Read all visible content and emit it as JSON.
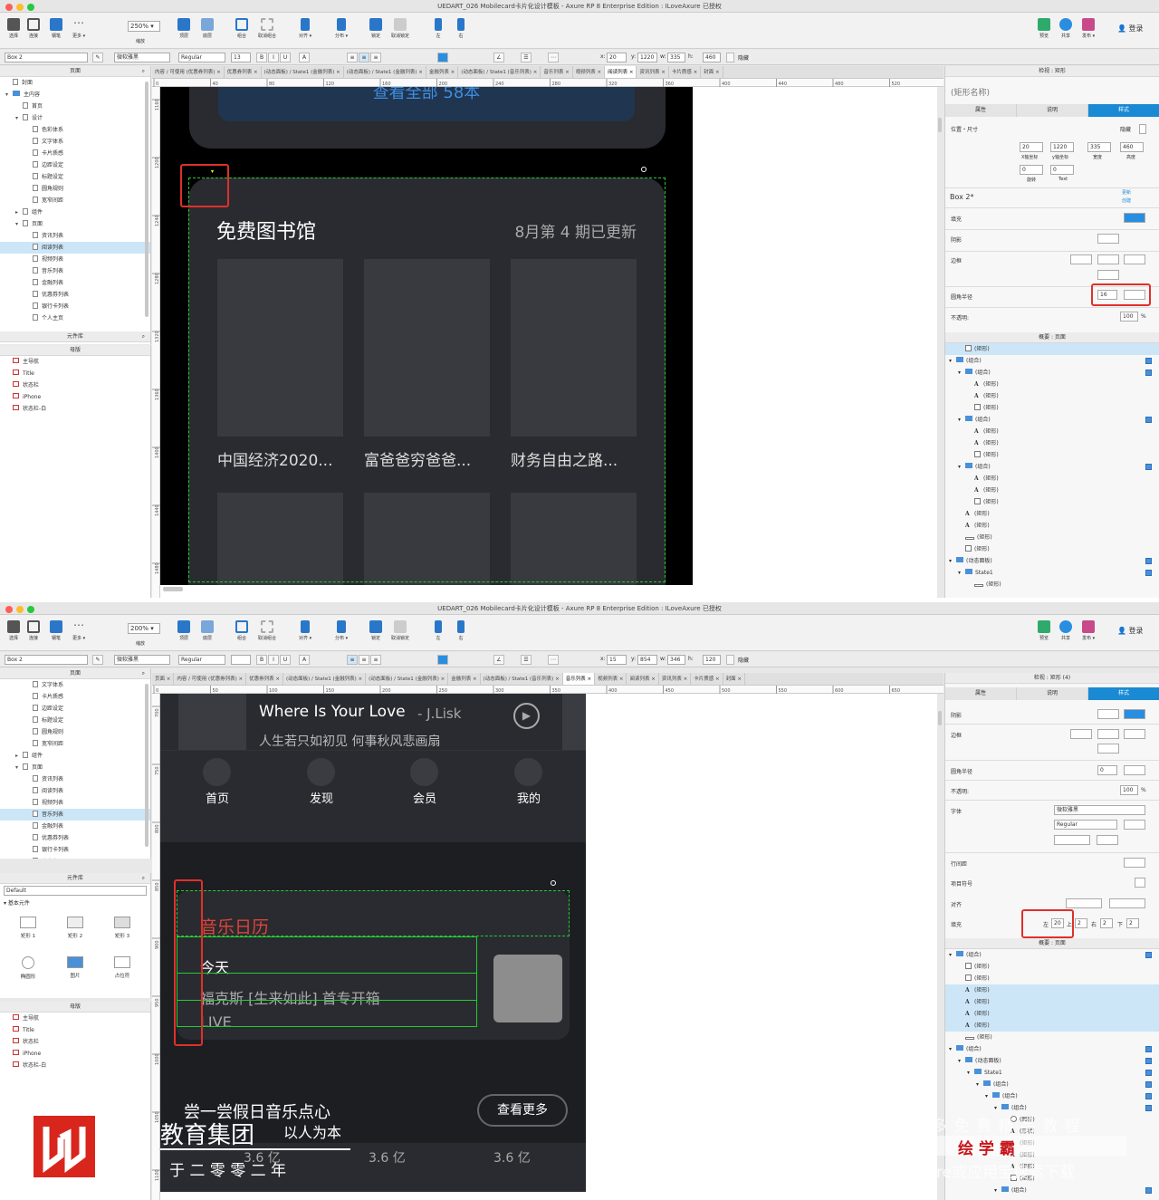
{
  "window1": {
    "title": "UEDART_026 Mobilecard卡片化设计模板 - Axure RP 8 Enterprise Edition : ILoveAxure 已授权",
    "toolbar": {
      "select": "选择",
      "connect": "连接",
      "pen": "钢笔",
      "more": "更多 ▾",
      "zoom": "250%",
      "zoom_label": "缩放",
      "top": "顶层",
      "bottom": "底层",
      "group": "组合",
      "ungroup": "取消组合",
      "align": "对齐 ▾",
      "distribute": "分布 ▾",
      "lock": "锁定",
      "unlock": "取消锁定",
      "left": "左",
      "right": "右",
      "preview": "预览",
      "share": "共享",
      "publish": "发布 ▾",
      "login": "登录"
    },
    "format": {
      "widget": "Box 2",
      "font": "微软雅黑",
      "weight": "Regular",
      "size": "13",
      "x_label": "x:",
      "x": "20",
      "y_label": "y:",
      "y": "1220",
      "w_label": "w:",
      "w": "335",
      "h_label": "h:",
      "h": "460",
      "hide": "隐藏"
    },
    "pages_title": "页面",
    "pages": [
      {
        "t": "封面",
        "lv": 0,
        "k": "pg"
      },
      {
        "t": "主内容",
        "lv": 0,
        "k": "fd",
        "tog": "▾"
      },
      {
        "t": "首页",
        "lv": 1,
        "k": "pg"
      },
      {
        "t": "设计",
        "lv": 1,
        "k": "pg",
        "tog": "▾"
      },
      {
        "t": "色彩体系",
        "lv": 2,
        "k": "pg"
      },
      {
        "t": "文字体系",
        "lv": 2,
        "k": "pg"
      },
      {
        "t": "卡片质感",
        "lv": 2,
        "k": "pg"
      },
      {
        "t": "边距设定",
        "lv": 2,
        "k": "pg"
      },
      {
        "t": "标题设定",
        "lv": 2,
        "k": "pg"
      },
      {
        "t": "圆角规则",
        "lv": 2,
        "k": "pg"
      },
      {
        "t": "宽窄间距",
        "lv": 2,
        "k": "pg"
      },
      {
        "t": "组件",
        "lv": 1,
        "k": "pg",
        "tog": "▸"
      },
      {
        "t": "页面",
        "lv": 1,
        "k": "pg",
        "tog": "▾"
      },
      {
        "t": "资讯列表",
        "lv": 2,
        "k": "pg"
      },
      {
        "t": "阅读列表",
        "lv": 2,
        "k": "pg",
        "sel": true
      },
      {
        "t": "视频列表",
        "lv": 2,
        "k": "pg"
      },
      {
        "t": "音乐列表",
        "lv": 2,
        "k": "pg"
      },
      {
        "t": "金融列表",
        "lv": 2,
        "k": "pg"
      },
      {
        "t": "优惠券列表",
        "lv": 2,
        "k": "pg"
      },
      {
        "t": "银行卡列表",
        "lv": 2,
        "k": "pg"
      },
      {
        "t": "个人主页",
        "lv": 2,
        "k": "pg"
      }
    ],
    "library_title": "元件库",
    "masters_title": "母版",
    "masters": [
      "主导航",
      "Title",
      "状态栏",
      "iPhone",
      "状态栏-白"
    ],
    "tabs": [
      "内容 / 可使用 (优惠券列表)",
      "优惠券列表",
      "(动态面板) / State1 (金融列表)",
      "(动态面板) / State1 (金融列表)",
      "金融列表",
      "(动态面板) / State1 (音乐列表)",
      "音乐列表",
      "视频列表",
      "阅读列表",
      "资讯列表",
      "卡片质感",
      "封面"
    ],
    "active_tab": 8,
    "hticks": [
      "0",
      "40",
      "80",
      "120",
      "160",
      "200",
      "240",
      "280",
      "320",
      "360",
      "400",
      "440",
      "480",
      "520"
    ],
    "vticks": [
      "1160",
      "1200",
      "1240",
      "1280",
      "1320",
      "1360",
      "1400",
      "1440",
      "1480"
    ],
    "canvas": {
      "top_text": "查看全部 58本",
      "title": "免费图书馆",
      "subtitle": "8月第 4 期已更新",
      "books": [
        "中国经济2020...",
        "富爸爸穷爸爸...",
        "财务自由之路..."
      ]
    },
    "inspector": {
      "title": "检视 : 矩形",
      "name_placeholder": "(矩形名称)",
      "tabs": [
        "属性",
        "说明",
        "样式"
      ],
      "hidden": "隐藏",
      "pos_size": "位置・尺寸",
      "x": "20",
      "y": "1220",
      "w": "335",
      "h": "460",
      "x_cap": "X轴坐标",
      "y_cap": "y轴坐标",
      "w_cap": "宽度",
      "h_cap": "高度",
      "rot": "0",
      "text_rot": "0",
      "rot_cap": "旋转",
      "text_cap": "Text",
      "style_name": "Box 2*",
      "update": "更新",
      "create": "创建",
      "fill": "填充",
      "shadow": "阴影",
      "border": "边框",
      "radius": "圆角半径",
      "radius_val": "16",
      "opacity": "不透明:",
      "opacity_val": "100",
      "pct": "%"
    },
    "outline_title": "概要 : 页面",
    "outline": [
      {
        "t": "(矩形)",
        "lv": 1,
        "k": "r",
        "sel": true
      },
      {
        "t": "(组合)",
        "lv": 0,
        "k": "g",
        "tog": "▾"
      },
      {
        "t": "(组合)",
        "lv": 1,
        "k": "g",
        "tog": "▾"
      },
      {
        "t": "(矩形)",
        "lv": 2,
        "k": "a"
      },
      {
        "t": "(矩形)",
        "lv": 2,
        "k": "a"
      },
      {
        "t": "(矩形)",
        "lv": 2,
        "k": "r"
      },
      {
        "t": "(组合)",
        "lv": 1,
        "k": "g",
        "tog": "▾"
      },
      {
        "t": "(矩形)",
        "lv": 2,
        "k": "a"
      },
      {
        "t": "(矩形)",
        "lv": 2,
        "k": "a"
      },
      {
        "t": "(矩形)",
        "lv": 2,
        "k": "r"
      },
      {
        "t": "(组合)",
        "lv": 1,
        "k": "g",
        "tog": "▾"
      },
      {
        "t": "(矩形)",
        "lv": 2,
        "k": "a"
      },
      {
        "t": "(矩形)",
        "lv": 2,
        "k": "a"
      },
      {
        "t": "(矩形)",
        "lv": 2,
        "k": "r"
      },
      {
        "t": "(矩形)",
        "lv": 1,
        "k": "a"
      },
      {
        "t": "(矩形)",
        "lv": 1,
        "k": "a"
      },
      {
        "t": "(矩形)",
        "lv": 1,
        "k": "l"
      },
      {
        "t": "(矩形)",
        "lv": 1,
        "k": "r"
      },
      {
        "t": "(动态面板)",
        "lv": 0,
        "k": "g",
        "tog": "▾"
      },
      {
        "t": "State1",
        "lv": 1,
        "k": "s",
        "tog": "▾"
      },
      {
        "t": "(矩形)",
        "lv": 2,
        "k": "l"
      }
    ]
  },
  "window2": {
    "title": "UEDART_026 Mobilecard卡片化设计模板 - Axure RP 8 Enterprise Edition : ILoveAxure 已授权",
    "toolbar": {
      "select": "选择",
      "connect": "连接",
      "pen": "钢笔",
      "more": "更多 ▾",
      "zoom": "200%",
      "zoom_label": "缩放",
      "top": "顶层",
      "bottom": "底层",
      "group": "组合",
      "ungroup": "取消组合",
      "align": "对齐 ▾",
      "distribute": "分布 ▾",
      "lock": "锁定",
      "unlock": "取消锁定",
      "left": "左",
      "right": "右",
      "preview": "预览",
      "share": "共享",
      "publish": "发布 ▾",
      "login": "登录"
    },
    "format": {
      "widget": "Box 2",
      "font": "微软雅黑",
      "weight": "Regular",
      "size": "",
      "x_label": "x:",
      "x": "15",
      "y_label": "y:",
      "y": "854",
      "w_label": "w:",
      "w": "346",
      "h_label": "h:",
      "h": "120",
      "hide": "隐藏"
    },
    "pages_title": "页面",
    "pages": [
      {
        "t": "文字体系",
        "lv": 2,
        "k": "pg"
      },
      {
        "t": "卡片质感",
        "lv": 2,
        "k": "pg"
      },
      {
        "t": "边距设定",
        "lv": 2,
        "k": "pg"
      },
      {
        "t": "标题设定",
        "lv": 2,
        "k": "pg"
      },
      {
        "t": "圆角规则",
        "lv": 2,
        "k": "pg"
      },
      {
        "t": "宽窄间距",
        "lv": 2,
        "k": "pg"
      },
      {
        "t": "组件",
        "lv": 1,
        "k": "pg",
        "tog": "▸"
      },
      {
        "t": "页面",
        "lv": 1,
        "k": "pg",
        "tog": "▾"
      },
      {
        "t": "资讯列表",
        "lv": 2,
        "k": "pg"
      },
      {
        "t": "阅读列表",
        "lv": 2,
        "k": "pg"
      },
      {
        "t": "视频列表",
        "lv": 2,
        "k": "pg"
      },
      {
        "t": "音乐列表",
        "lv": 2,
        "k": "pg",
        "sel": true
      },
      {
        "t": "金融列表",
        "lv": 2,
        "k": "pg"
      },
      {
        "t": "优惠券列表",
        "lv": 2,
        "k": "pg"
      },
      {
        "t": "银行卡列表",
        "lv": 2,
        "k": "pg"
      },
      {
        "t": "个人主页",
        "lv": 2,
        "k": "pg"
      }
    ],
    "library_title": "元件库",
    "library_select": "Default",
    "library_group": "基本元件",
    "widgets": [
      "矩形 1",
      "矩形 2",
      "矩形 3",
      "椭圆形",
      "图片",
      "占位符"
    ],
    "masters_title": "母版",
    "masters": [
      "主导航",
      "Title",
      "状态栏",
      "iPhone",
      "状态栏-白"
    ],
    "tabs": [
      "页面",
      "内容 / 可使用 (优惠券列表)",
      "优惠券列表",
      "(动态面板) / State1 (金融列表)",
      "(动态面板) / State1 (金融列表)",
      "金融列表",
      "(动态面板) / State1 (音乐列表)",
      "音乐列表",
      "视频列表",
      "阅读列表",
      "资讯列表",
      "卡片质感",
      "封面"
    ],
    "active_tab": 7,
    "hticks": [
      "0",
      "50",
      "100",
      "150",
      "200",
      "250",
      "300",
      "350",
      "400",
      "450",
      "500",
      "550",
      "600",
      "650"
    ],
    "vticks": [
      "700",
      "750",
      "800",
      "850",
      "900",
      "950",
      "1000",
      "1050",
      "1100"
    ],
    "canvas": {
      "song": "Where Is Your Love",
      "artist": "- J.Lisk",
      "lyric": "人生若只如初见 何事秋风悲画扇",
      "nav": [
        "首页",
        "发现",
        "会员",
        "我的"
      ],
      "section": "音乐日历",
      "today": "今天",
      "item": "福克斯 [生来如此] 首专开箱",
      "live": "LIVE",
      "tag1": "尝一尝假日音乐点心",
      "more": "查看更多",
      "vals": [
        "3.6 亿",
        "3.6 亿",
        "3.6 亿"
      ],
      "brand1": "教育集团",
      "brand2": "以人为本",
      "brand3": "于 二 零 零 二 年"
    },
    "inspector": {
      "title": "检视 : 矩形 (4)",
      "tabs": [
        "属性",
        "说明",
        "样式"
      ],
      "shadow": "阴影",
      "border": "边框",
      "radius": "圆角半径",
      "radius_val": "0",
      "opacity": "不透明:",
      "opacity_val": "100",
      "pct": "%",
      "font_label": "字体",
      "font": "微软雅黑",
      "weight": "Regular",
      "line": "行间距",
      "bullet": "项目符号",
      "align": "对齐",
      "padding": "填充",
      "pad_l_label": "左",
      "pad_l": "20",
      "pad_t_label": "上",
      "pad_t": "2",
      "pad_r_label": "右",
      "pad_r": "2",
      "pad_b_label": "下",
      "pad_b": "2"
    },
    "outline_title": "概要 : 页面",
    "outline": [
      {
        "t": "(组合)",
        "lv": 0,
        "k": "g",
        "tog": "▾"
      },
      {
        "t": "(矩形)",
        "lv": 1,
        "k": "r"
      },
      {
        "t": "(矩形)",
        "lv": 1,
        "k": "r"
      },
      {
        "t": "(矩形)",
        "lv": 1,
        "k": "a",
        "sel": true
      },
      {
        "t": "(矩形)",
        "lv": 1,
        "k": "a",
        "sel": true
      },
      {
        "t": "(矩形)",
        "lv": 1,
        "k": "a",
        "sel": true
      },
      {
        "t": "(矩形)",
        "lv": 1,
        "k": "a",
        "sel": true
      },
      {
        "t": "(矩形)",
        "lv": 1,
        "k": "l"
      },
      {
        "t": "(组合)",
        "lv": 0,
        "k": "g",
        "tog": "▾"
      },
      {
        "t": "(动态面板)",
        "lv": 1,
        "k": "g",
        "tog": "▾"
      },
      {
        "t": "State1",
        "lv": 2,
        "k": "s",
        "tog": "▾"
      },
      {
        "t": "(组合)",
        "lv": 3,
        "k": "g",
        "tog": "▾"
      },
      {
        "t": "(组合)",
        "lv": 4,
        "k": "g",
        "tog": "▾"
      },
      {
        "t": "(组合)",
        "lv": 5,
        "k": "g",
        "tog": "▾"
      },
      {
        "t": "(图标)",
        "lv": 6,
        "k": "o"
      },
      {
        "t": "(形状)",
        "lv": 6,
        "k": "a"
      },
      {
        "t": "(矩形)",
        "lv": 6,
        "k": "a"
      },
      {
        "t": "(矩形)",
        "lv": 6,
        "k": "a"
      },
      {
        "t": "(矩形)",
        "lv": 6,
        "k": "a"
      },
      {
        "t": "(矩形)",
        "lv": 6,
        "k": "r"
      },
      {
        "t": "(组合)",
        "lv": 5,
        "k": "g",
        "tog": "▾"
      }
    ]
  },
  "watermark": {
    "line1": "获 得 更 多 免 费 精 品 教 程",
    "brand": "绘 学 霸",
    "line2": "在AppStore或应用宝搜索下载"
  },
  "colors": {
    "accent": "#1a8ad4",
    "highlight": "#e0302b",
    "selection": "#22cc33",
    "music_red": "#e0433a",
    "dark_bg": "#1d1e22",
    "card_bg": "#2a2b30",
    "placeholder": "#383a40"
  }
}
